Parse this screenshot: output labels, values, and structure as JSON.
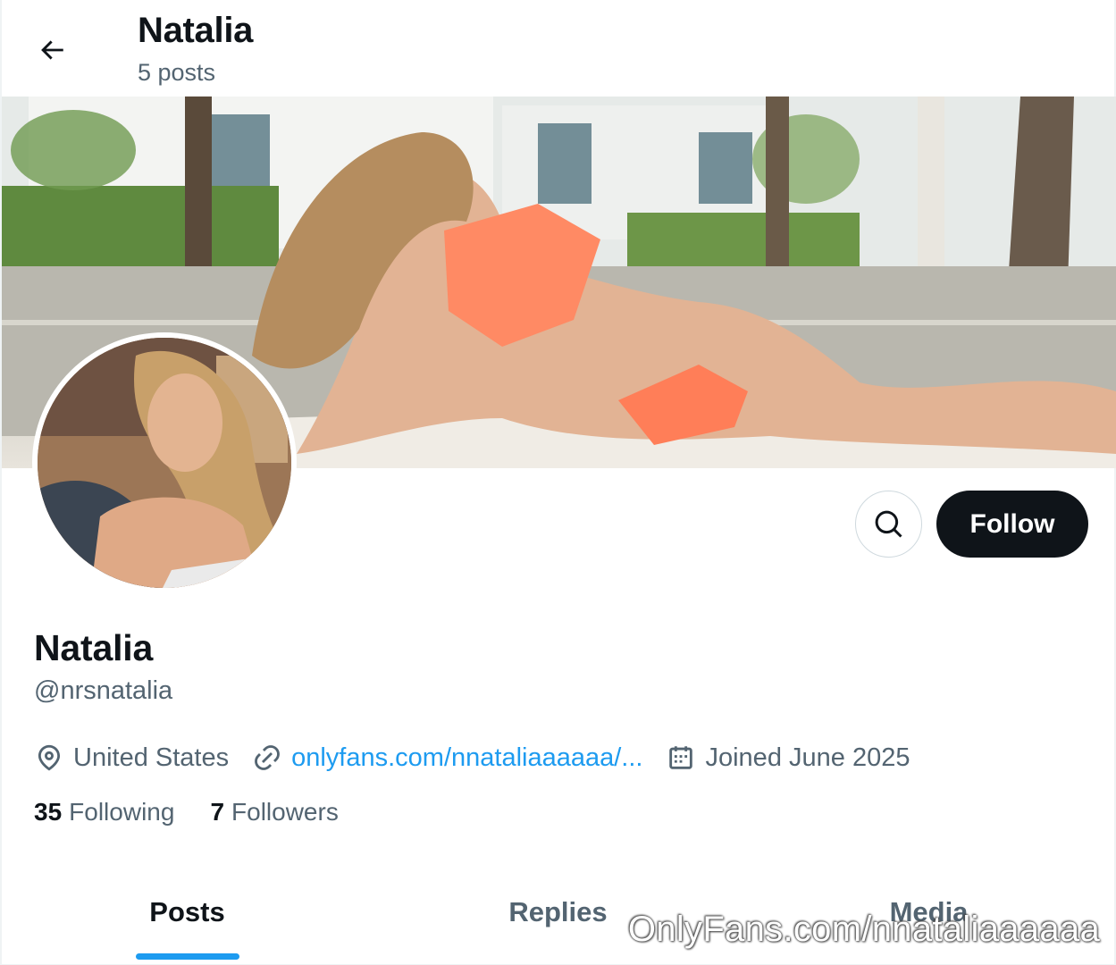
{
  "header": {
    "name": "Natalia",
    "posts": "5 posts"
  },
  "profile": {
    "display_name": "Natalia",
    "handle": "@nrsnatalia",
    "location": "United States",
    "link": "onlyfans.com/nnataliaaaaaa/...",
    "joined": "Joined June 2025"
  },
  "stats": {
    "following_count": "35",
    "following_label": "Following",
    "followers_count": "7",
    "followers_label": "Followers"
  },
  "actions": {
    "follow_label": "Follow"
  },
  "tabs": [
    {
      "label": "Posts",
      "active": true
    },
    {
      "label": "Replies",
      "active": false
    },
    {
      "label": "Media",
      "active": false
    }
  ],
  "watermark": "OnlyFans.com/nnataliaaaaaa",
  "icons": {
    "back": "arrow-left-icon",
    "search": "search-icon",
    "location": "location-pin-icon",
    "link": "link-icon",
    "calendar": "calendar-icon"
  },
  "colors": {
    "accent": "#1d9bf0",
    "text": "#0f1419",
    "secondary_text": "#536471",
    "button_dark": "#0f1419"
  }
}
